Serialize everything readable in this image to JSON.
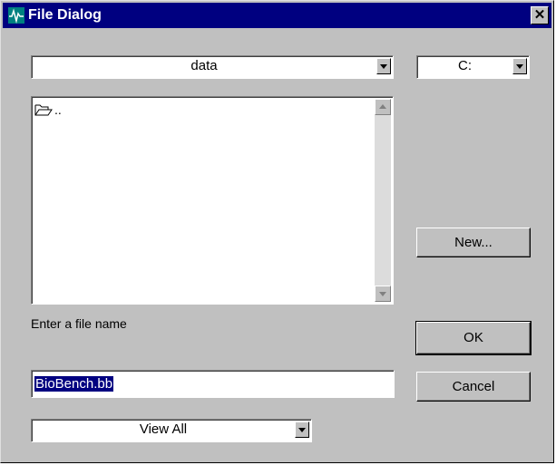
{
  "window": {
    "title": "File Dialog",
    "close_label": "✕",
    "title_icon": "waveform-icon"
  },
  "folder_combo": {
    "value": "data"
  },
  "drive_combo": {
    "value": "C:"
  },
  "file_list": {
    "items": [
      {
        "icon": "folder-open-icon",
        "label": ".."
      }
    ]
  },
  "new_button": {
    "label": "New..."
  },
  "file_name": {
    "prompt": "Enter a file name",
    "value": "BioBench.bb"
  },
  "ok_button": {
    "label": "OK"
  },
  "cancel_button": {
    "label": "Cancel"
  },
  "filter_combo": {
    "value": "View All"
  },
  "colors": {
    "title_bar": "#000080",
    "face": "#c0c0c0",
    "selection": "#000080"
  }
}
